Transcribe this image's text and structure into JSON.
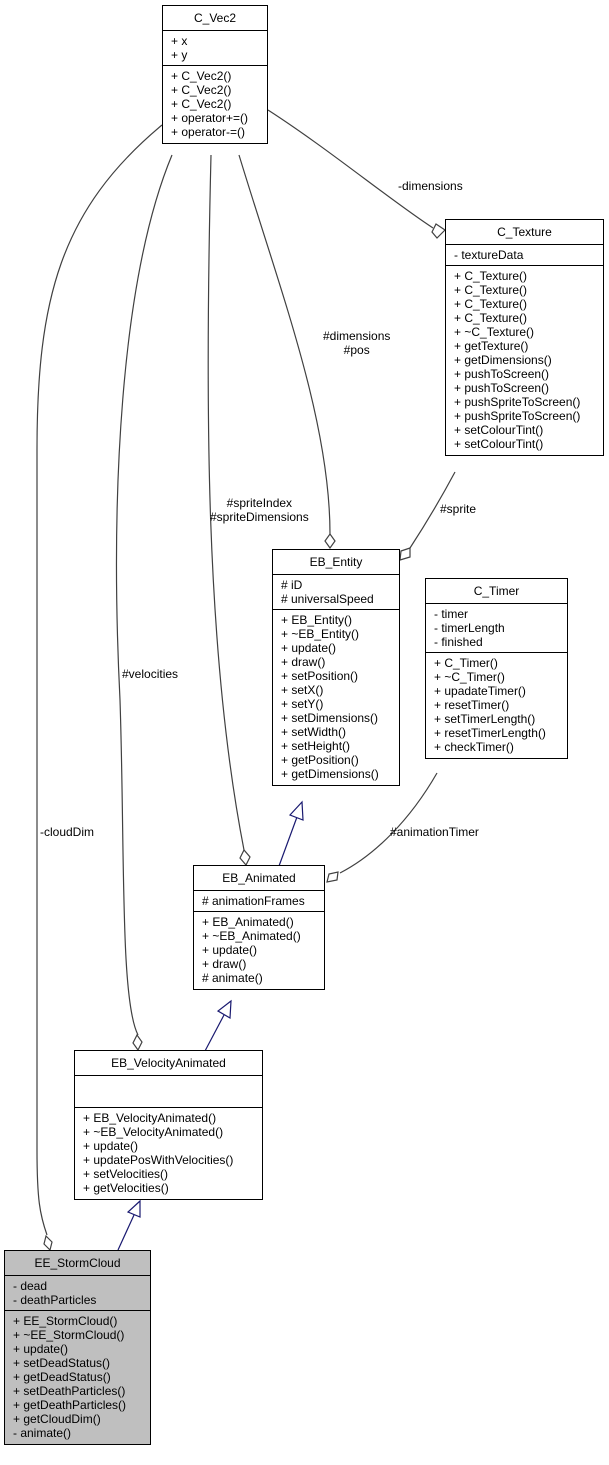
{
  "classes": {
    "c_vec2": {
      "name": "C_Vec2",
      "attributes": [
        "+ x",
        "+ y"
      ],
      "operations": [
        "+ C_Vec2()",
        "+ C_Vec2()",
        "+ C_Vec2()",
        "+ operator+=()",
        "+ operator-=()"
      ]
    },
    "c_texture": {
      "name": "C_Texture",
      "attributes": [
        "- textureData"
      ],
      "operations": [
        "+ C_Texture()",
        "+ C_Texture()",
        "+ C_Texture()",
        "+ C_Texture()",
        "+ ~C_Texture()",
        "+ getTexture()",
        "+ getDimensions()",
        "+ pushToScreen()",
        "+ pushToScreen()",
        "+ pushSpriteToScreen()",
        "+ pushSpriteToScreen()",
        "+ setColourTint()",
        "+ setColourTint()"
      ]
    },
    "eb_entity": {
      "name": "EB_Entity",
      "attributes": [
        "# iD",
        "# universalSpeed"
      ],
      "operations": [
        "+ EB_Entity()",
        "+ ~EB_Entity()",
        "+ update()",
        "+ draw()",
        "+ setPosition()",
        "+ setX()",
        "+ setY()",
        "+ setDimensions()",
        "+ setWidth()",
        "+ setHeight()",
        "+ getPosition()",
        "+ getDimensions()"
      ]
    },
    "c_timer": {
      "name": "C_Timer",
      "attributes": [
        "- timer",
        "- timerLength",
        "- finished"
      ],
      "operations": [
        "+ C_Timer()",
        "+ ~C_Timer()",
        "+ upadateTimer()",
        "+ resetTimer()",
        "+ setTimerLength()",
        "+ resetTimerLength()",
        "+ checkTimer()"
      ]
    },
    "eb_animated": {
      "name": "EB_Animated",
      "attributes": [
        "# animationFrames"
      ],
      "operations": [
        "+ EB_Animated()",
        "+ ~EB_Animated()",
        "+ update()",
        "+ draw()",
        "# animate()"
      ]
    },
    "eb_velocityanimated": {
      "name": "EB_VelocityAnimated",
      "attributes": [],
      "operations": [
        "+ EB_VelocityAnimated()",
        "+ ~EB_VelocityAnimated()",
        "+ update()",
        "+ updatePosWithVelocities()",
        "+ setVelocities()",
        "+ getVelocities()"
      ]
    },
    "ee_stormcloud": {
      "name": "EE_StormCloud",
      "attributes": [
        "- dead",
        "- deathParticles"
      ],
      "operations": [
        "+ EE_StormCloud()",
        "+ ~EE_StormCloud()",
        "+ update()",
        "+ setDeadStatus()",
        "+ getDeadStatus()",
        "+ setDeathParticles()",
        "+ getDeathParticles()",
        "+ getCloudDim()",
        "- animate()"
      ]
    }
  },
  "edges": {
    "dimensions_texture": "-dimensions",
    "entity_dims_pos": [
      "#dimensions",
      "#pos"
    ],
    "sprite_index_dims": [
      "#spriteIndex",
      "#spriteDimensions"
    ],
    "sprite": "#sprite",
    "velocities": "#velocities",
    "cloud_dim": "-cloudDim",
    "animation_timer": "#animationTimer"
  },
  "colors": {
    "focus_fill": "#bfbfbf",
    "association": "#404040",
    "inheritance": "#191970"
  }
}
